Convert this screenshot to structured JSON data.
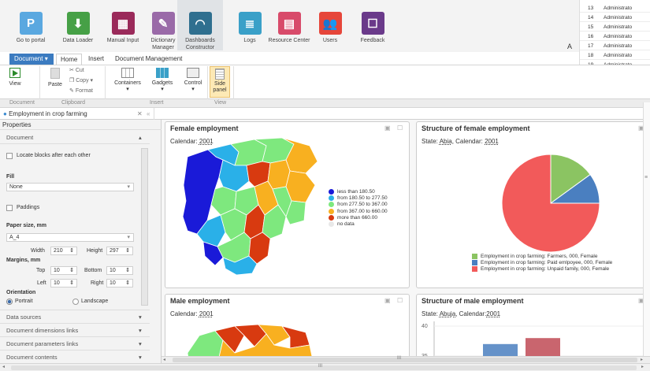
{
  "launcher": [
    {
      "label": "Go to portal",
      "color": "#5aa8e0",
      "icon": "portal-icon"
    },
    {
      "label": "Data Loader",
      "color": "#46a046",
      "icon": "download-icon"
    },
    {
      "label": "Manual Input",
      "color": "#9a2a5a",
      "icon": "table-icon"
    },
    {
      "label": "Dictionary Manager",
      "color": "#9a6aa8",
      "icon": "edit-icon"
    },
    {
      "label": "Dashboards Constructor",
      "color": "#2f6f8f",
      "icon": "gauge-icon"
    },
    {
      "label": "Logs",
      "color": "#3aa0c8",
      "icon": "log-icon"
    },
    {
      "label": "Resource Center",
      "color": "#d84b6a",
      "icon": "resource-icon"
    },
    {
      "label": "Users",
      "color": "#e6463a",
      "icon": "users-icon"
    },
    {
      "label": "Feedback",
      "color": "#6a3a8a",
      "icon": "feedback-icon"
    }
  ],
  "launcher_extra": "A",
  "menu": {
    "document": "Document",
    "tabs": [
      "Home",
      "Insert",
      "Document Management"
    ]
  },
  "ribbon": {
    "view": "View",
    "paste": "Paste",
    "cut": "Cut",
    "copy": "Copy",
    "format": "Format",
    "containers": "Containers",
    "gadgets": "Gadgets",
    "control": "Control",
    "side_panel": "Side panel"
  },
  "groups": {
    "document": "Document",
    "clipboard": "Clipboard",
    "insert": "Insert",
    "view": "View"
  },
  "doc_tab": "Employment in crop farming",
  "properties": {
    "title": "Properties",
    "section": "Document",
    "locate": "Locate blocks after each other",
    "fill_label": "Fill",
    "fill_value": "None",
    "paddings": "Paddings",
    "paper_label": "Paper size, mm",
    "paper_value": "A_4",
    "width_label": "Width",
    "width": "210",
    "height_label": "Height",
    "height": "297",
    "margins_label": "Margins, mm",
    "top_label": "Top",
    "top": "10",
    "bottom_label": "Bottom",
    "bottom": "10",
    "left_label": "Left",
    "left": "10",
    "right_label": "Right",
    "right": "10",
    "orientation": "Orientation",
    "portrait": "Portrait",
    "landscape": "Landscape",
    "sections": [
      "Data sources",
      "Document dimensions links",
      "Document parameters links",
      "Document contents"
    ]
  },
  "panels": {
    "female_title": "Female employment",
    "female_calendar_label": "Calendar:",
    "female_calendar": "2001",
    "struct_f_title": "Structure of female employment",
    "struct_f_state_label": "State:",
    "struct_f_state": "Abia",
    "struct_f_cal_label": "Calendar:",
    "struct_f_cal": "2001",
    "male_title": "Male employment",
    "male_calendar_label": "Calendar:",
    "male_calendar": "2001",
    "struct_m_title": "Structure of male employment",
    "struct_m_state_label": "State:",
    "struct_m_state": "Abuja",
    "struct_m_cal_label": "Calendar:",
    "struct_m_cal": "2001"
  },
  "map_legend": [
    {
      "label": "less than 180.50",
      "color": "#1a1ad8"
    },
    {
      "label": "from 180.50 to 277.50",
      "color": "#2ab0e8"
    },
    {
      "label": "from 277.50 to 367.00",
      "color": "#7ee87e"
    },
    {
      "label": "from 367.00 to 660.00",
      "color": "#f8b020"
    },
    {
      "label": "more than 660.00",
      "color": "#d83a10"
    },
    {
      "label": "no data",
      "color": "#e8e8e8"
    }
  ],
  "chart_data": [
    {
      "type": "pie",
      "title": "Structure of female employment",
      "series": [
        {
          "name": "Employment in crop farming: Farmers, 000, Female",
          "value": 0.15,
          "color": "#8bc462"
        },
        {
          "name": "Employment in crop farming: Paid emlpoyee, 000, Female",
          "value": 0.1,
          "color": "#4a7fc0"
        },
        {
          "name": "Employment in crop farming: Unpaid family, 000, Female",
          "value": 0.75,
          "color": "#f25a5a"
        }
      ]
    },
    {
      "type": "bar",
      "title": "Structure of male employment",
      "yticks": [
        "40",
        "35"
      ],
      "values": [
        37,
        38
      ],
      "colors": [
        "#4a7fc0",
        "#c04a55"
      ]
    }
  ],
  "mini_table": {
    "rows": [
      {
        "n": "13",
        "a": "Administrato"
      },
      {
        "n": "14",
        "a": "Administrato"
      },
      {
        "n": "15",
        "a": "Administrato"
      },
      {
        "n": "16",
        "a": "Administrato"
      },
      {
        "n": "17",
        "a": "Administrato"
      },
      {
        "n": "18",
        "a": "Administrato"
      },
      {
        "n": "19",
        "a": "Administrato"
      },
      {
        "n": "20",
        "a": "Administrato"
      }
    ]
  },
  "scroll": {
    "h_label": "III"
  }
}
